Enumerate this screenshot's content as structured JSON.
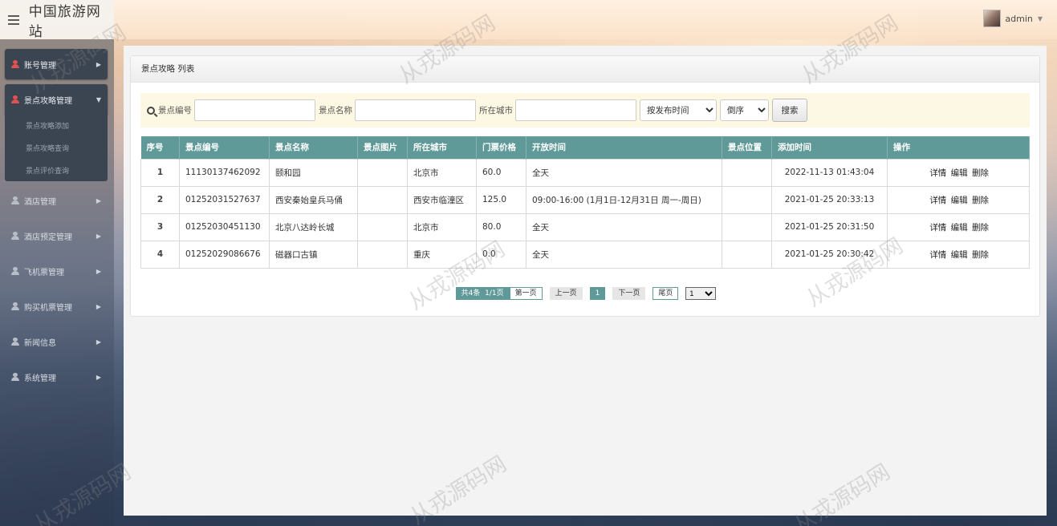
{
  "header": {
    "app_title": "中国旅游网站",
    "user_name": "admin"
  },
  "sidebar": {
    "items": [
      {
        "label": "账号管理",
        "icon": "user-icon"
      },
      {
        "label": "景点攻略管理",
        "icon": "user-icon"
      },
      {
        "label": "酒店管理",
        "icon": "user-icon"
      },
      {
        "label": "酒店预定管理",
        "icon": "user-icon"
      },
      {
        "label": "飞机票管理",
        "icon": "user-icon"
      },
      {
        "label": "购买机票管理",
        "icon": "user-icon"
      },
      {
        "label": "新闻信息",
        "icon": "user-icon"
      },
      {
        "label": "系统管理",
        "icon": "user-icon"
      }
    ],
    "submenu": [
      "景点攻略添加",
      "景点攻略查询",
      "景点评价查询"
    ]
  },
  "panel": {
    "title": "景点攻略 列表"
  },
  "search": {
    "code_label": "景点编号",
    "name_label": "景点名称",
    "city_label": "所在城市",
    "sort_field": "按发布时间",
    "sort_order": "倒序",
    "button": "搜索"
  },
  "table": {
    "headers": [
      "序号",
      "景点编号",
      "景点名称",
      "景点图片",
      "所在城市",
      "门票价格",
      "开放时间",
      "景点位置",
      "添加时间",
      "操作"
    ],
    "rows": [
      {
        "idx": "1",
        "code": "11130137462092",
        "name": "颐和园",
        "img": "",
        "city": "北京市",
        "price": "60.0",
        "open": "全天",
        "loc": "",
        "added": "2022-11-13 01:43:04"
      },
      {
        "idx": "2",
        "code": "01252031527637",
        "name": "西安秦始皇兵马俑",
        "img": "",
        "city": "西安市临潼区",
        "price": "125.0",
        "open": "09:00-16:00 (1月1日-12月31日 周一-周日)",
        "loc": "",
        "added": "2021-01-25 20:33:13"
      },
      {
        "idx": "3",
        "code": "01252030451130",
        "name": "北京八达岭长城",
        "img": "",
        "city": "北京市",
        "price": "80.0",
        "open": "全天",
        "loc": "",
        "added": "2021-01-25 20:31:50"
      },
      {
        "idx": "4",
        "code": "01252029086676",
        "name": "磁器口古镇",
        "img": "",
        "city": "重庆",
        "price": "0.0",
        "open": "全天",
        "loc": "",
        "added": "2021-01-25 20:30:42"
      }
    ],
    "ops": {
      "detail": "详情",
      "edit": "编辑",
      "delete": "删除"
    }
  },
  "pager": {
    "total": "共4条",
    "pages": "1/1页",
    "first": "第一页",
    "prev": "上一页",
    "current": "1",
    "next": "下一页",
    "last": "尾页",
    "select_value": "1"
  },
  "watermark": "从戎源码网",
  "colors": {
    "accent": "#5f9a98",
    "sidebar_box": "#3b4552",
    "search_bg": "#fcf8e3",
    "active_icon": "#e05151"
  }
}
